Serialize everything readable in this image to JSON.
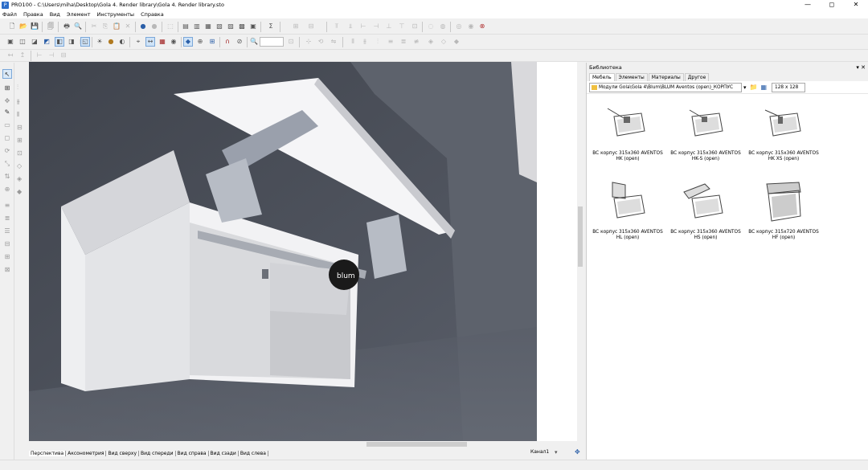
{
  "window": {
    "title": "PRO100 - C:\\Users\\miha\\Desktop\\Gola 4. Render library\\Gola 4. Render library.sto",
    "minimize": "—",
    "maximize": "◻",
    "close": "✕"
  },
  "menu": [
    "Файл",
    "Правка",
    "Вид",
    "Элемент",
    "Инструменты",
    "Справка"
  ],
  "view_tabs": [
    "Перспектива",
    "Аксонометрия",
    "Вид сверху",
    "Вид спереди",
    "Вид справа",
    "Вид сзади",
    "Вид слева"
  ],
  "channel": "Канал1",
  "library": {
    "title": "Библиотека",
    "tabs": [
      "Мебель",
      "Элементы",
      "Материалы",
      "Другое"
    ],
    "path": "Модули Gola\\Gola 4\\Blum\\BLUM Aventos (open)_КОРПУС",
    "thumb_size": "128 x 128",
    "items": [
      {
        "label": "ВС корпус 315х360 AVENTOS HK (open)",
        "kind": "hk"
      },
      {
        "label": "ВС корпус 315х360 AVENTOS HK-S (open)",
        "kind": "hks"
      },
      {
        "label": "ВС корпус 315х360 AVENTOS HK XS (open)",
        "kind": "hkxs"
      },
      {
        "label": "ВС корпус 315х360 AVENTOS HL (open)",
        "kind": "hl"
      },
      {
        "label": "ВС корпус 315х360 AVENTOS HS (open)",
        "kind": "hs"
      },
      {
        "label": "ВС корпус 315х720 AVENTOS HF (open)",
        "kind": "hf"
      }
    ]
  },
  "render": {
    "brand": "blum",
    "wall_color": "#4e535e",
    "cabinet_color": "#e9e9ec"
  }
}
